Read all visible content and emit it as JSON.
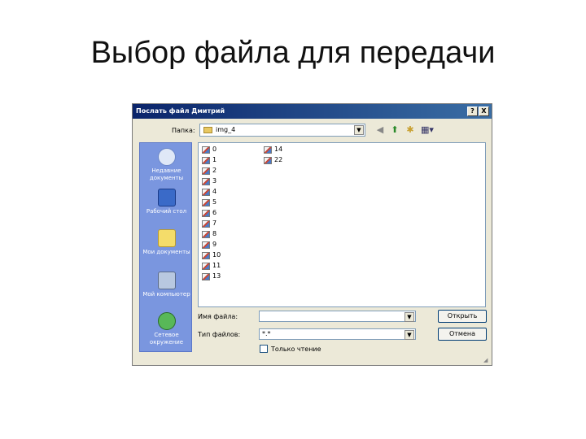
{
  "slide": {
    "title": "Выбор файла для передачи"
  },
  "dialog": {
    "title": "Послать файл Дмитрий",
    "help_button": "?",
    "close_button": "X",
    "look_in_label": "Папка:",
    "look_in_value": "img_4",
    "places": [
      {
        "label": "Недавние документы",
        "icon": "recent-documents-icon"
      },
      {
        "label": "Рабочий стол",
        "icon": "desktop-icon"
      },
      {
        "label": "Мои документы",
        "icon": "my-documents-icon"
      },
      {
        "label": "Мой компьютер",
        "icon": "my-computer-icon"
      },
      {
        "label": "Сетевое окружение",
        "icon": "network-places-icon"
      }
    ],
    "files_col1": [
      "0",
      "1",
      "2",
      "3",
      "4",
      "5",
      "6",
      "7",
      "8",
      "9",
      "10",
      "11",
      "13"
    ],
    "files_col2": [
      "14",
      "22"
    ],
    "file_name_label": "Имя файла:",
    "file_name_value": "",
    "file_type_label": "Тип файлов:",
    "file_type_value": "*.*",
    "open_button": "Открыть",
    "cancel_button": "Отмена",
    "readonly_label": "Только чтение",
    "readonly_checked": false
  },
  "colors": {
    "titlebar": "#0a246a",
    "places_panel": "#7a96df",
    "dialog_bg": "#ece9d8"
  }
}
